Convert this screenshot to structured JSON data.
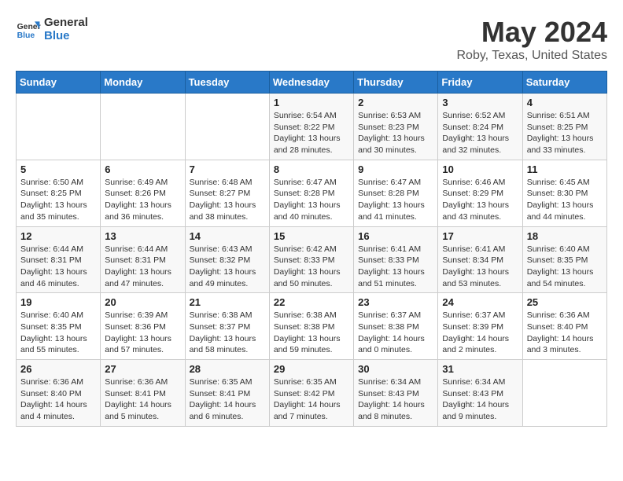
{
  "logo": {
    "line1": "General",
    "line2": "Blue"
  },
  "title": "May 2024",
  "subtitle": "Roby, Texas, United States",
  "days_of_week": [
    "Sunday",
    "Monday",
    "Tuesday",
    "Wednesday",
    "Thursday",
    "Friday",
    "Saturday"
  ],
  "weeks": [
    [
      {
        "day": "",
        "info": ""
      },
      {
        "day": "",
        "info": ""
      },
      {
        "day": "",
        "info": ""
      },
      {
        "day": "1",
        "info": "Sunrise: 6:54 AM\nSunset: 8:22 PM\nDaylight: 13 hours\nand 28 minutes."
      },
      {
        "day": "2",
        "info": "Sunrise: 6:53 AM\nSunset: 8:23 PM\nDaylight: 13 hours\nand 30 minutes."
      },
      {
        "day": "3",
        "info": "Sunrise: 6:52 AM\nSunset: 8:24 PM\nDaylight: 13 hours\nand 32 minutes."
      },
      {
        "day": "4",
        "info": "Sunrise: 6:51 AM\nSunset: 8:25 PM\nDaylight: 13 hours\nand 33 minutes."
      }
    ],
    [
      {
        "day": "5",
        "info": "Sunrise: 6:50 AM\nSunset: 8:25 PM\nDaylight: 13 hours\nand 35 minutes."
      },
      {
        "day": "6",
        "info": "Sunrise: 6:49 AM\nSunset: 8:26 PM\nDaylight: 13 hours\nand 36 minutes."
      },
      {
        "day": "7",
        "info": "Sunrise: 6:48 AM\nSunset: 8:27 PM\nDaylight: 13 hours\nand 38 minutes."
      },
      {
        "day": "8",
        "info": "Sunrise: 6:47 AM\nSunset: 8:28 PM\nDaylight: 13 hours\nand 40 minutes."
      },
      {
        "day": "9",
        "info": "Sunrise: 6:47 AM\nSunset: 8:28 PM\nDaylight: 13 hours\nand 41 minutes."
      },
      {
        "day": "10",
        "info": "Sunrise: 6:46 AM\nSunset: 8:29 PM\nDaylight: 13 hours\nand 43 minutes."
      },
      {
        "day": "11",
        "info": "Sunrise: 6:45 AM\nSunset: 8:30 PM\nDaylight: 13 hours\nand 44 minutes."
      }
    ],
    [
      {
        "day": "12",
        "info": "Sunrise: 6:44 AM\nSunset: 8:31 PM\nDaylight: 13 hours\nand 46 minutes."
      },
      {
        "day": "13",
        "info": "Sunrise: 6:44 AM\nSunset: 8:31 PM\nDaylight: 13 hours\nand 47 minutes."
      },
      {
        "day": "14",
        "info": "Sunrise: 6:43 AM\nSunset: 8:32 PM\nDaylight: 13 hours\nand 49 minutes."
      },
      {
        "day": "15",
        "info": "Sunrise: 6:42 AM\nSunset: 8:33 PM\nDaylight: 13 hours\nand 50 minutes."
      },
      {
        "day": "16",
        "info": "Sunrise: 6:41 AM\nSunset: 8:33 PM\nDaylight: 13 hours\nand 51 minutes."
      },
      {
        "day": "17",
        "info": "Sunrise: 6:41 AM\nSunset: 8:34 PM\nDaylight: 13 hours\nand 53 minutes."
      },
      {
        "day": "18",
        "info": "Sunrise: 6:40 AM\nSunset: 8:35 PM\nDaylight: 13 hours\nand 54 minutes."
      }
    ],
    [
      {
        "day": "19",
        "info": "Sunrise: 6:40 AM\nSunset: 8:35 PM\nDaylight: 13 hours\nand 55 minutes."
      },
      {
        "day": "20",
        "info": "Sunrise: 6:39 AM\nSunset: 8:36 PM\nDaylight: 13 hours\nand 57 minutes."
      },
      {
        "day": "21",
        "info": "Sunrise: 6:38 AM\nSunset: 8:37 PM\nDaylight: 13 hours\nand 58 minutes."
      },
      {
        "day": "22",
        "info": "Sunrise: 6:38 AM\nSunset: 8:38 PM\nDaylight: 13 hours\nand 59 minutes."
      },
      {
        "day": "23",
        "info": "Sunrise: 6:37 AM\nSunset: 8:38 PM\nDaylight: 14 hours\nand 0 minutes."
      },
      {
        "day": "24",
        "info": "Sunrise: 6:37 AM\nSunset: 8:39 PM\nDaylight: 14 hours\nand 2 minutes."
      },
      {
        "day": "25",
        "info": "Sunrise: 6:36 AM\nSunset: 8:40 PM\nDaylight: 14 hours\nand 3 minutes."
      }
    ],
    [
      {
        "day": "26",
        "info": "Sunrise: 6:36 AM\nSunset: 8:40 PM\nDaylight: 14 hours\nand 4 minutes."
      },
      {
        "day": "27",
        "info": "Sunrise: 6:36 AM\nSunset: 8:41 PM\nDaylight: 14 hours\nand 5 minutes."
      },
      {
        "day": "28",
        "info": "Sunrise: 6:35 AM\nSunset: 8:41 PM\nDaylight: 14 hours\nand 6 minutes."
      },
      {
        "day": "29",
        "info": "Sunrise: 6:35 AM\nSunset: 8:42 PM\nDaylight: 14 hours\nand 7 minutes."
      },
      {
        "day": "30",
        "info": "Sunrise: 6:34 AM\nSunset: 8:43 PM\nDaylight: 14 hours\nand 8 minutes."
      },
      {
        "day": "31",
        "info": "Sunrise: 6:34 AM\nSunset: 8:43 PM\nDaylight: 14 hours\nand 9 minutes."
      },
      {
        "day": "",
        "info": ""
      }
    ]
  ]
}
